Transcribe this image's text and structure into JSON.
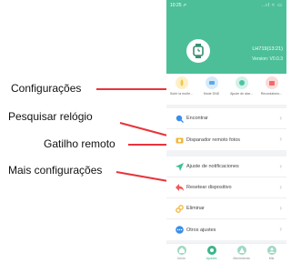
{
  "annotations": {
    "settings": "Configurações",
    "search_watch": "Pesquisar relógio",
    "remote_shutter": "Gatilho remoto",
    "more_settings": "Mais configurações"
  },
  "status_bar": {
    "time": "10:25 ⇗",
    "icons": "..ıl ≈ ▭"
  },
  "device": {
    "name": "LH719(13:21)",
    "version": "Version: V0.0.3"
  },
  "shortcuts": [
    {
      "label": "Subir la muñe...",
      "icon": "wrist-icon",
      "color": "#f5c742"
    },
    {
      "label": "Mode DND",
      "icon": "moon-icon",
      "color": "#5aa8e8"
    },
    {
      "label": "Ajuste de alar...",
      "icon": "alarm-icon",
      "color": "#4cc4a2"
    },
    {
      "label": "Recordatorio...",
      "icon": "reminder-icon",
      "color": "#ef6b6b"
    }
  ],
  "menu": {
    "find": "Encontrar",
    "remote_camera": "Disparador remoto fotos",
    "notifications": "Ajuste de notificaciones",
    "reset": "Resetear dispositivo",
    "delete": "Eliminar",
    "other": "Otros ajustes"
  },
  "tabs": [
    {
      "label": "Inicio"
    },
    {
      "label": "Ajustes"
    },
    {
      "label": "Movimiento"
    },
    {
      "label": "Mis"
    }
  ],
  "colors": {
    "header": "#4cbf99",
    "arrow": "#e8333c"
  }
}
